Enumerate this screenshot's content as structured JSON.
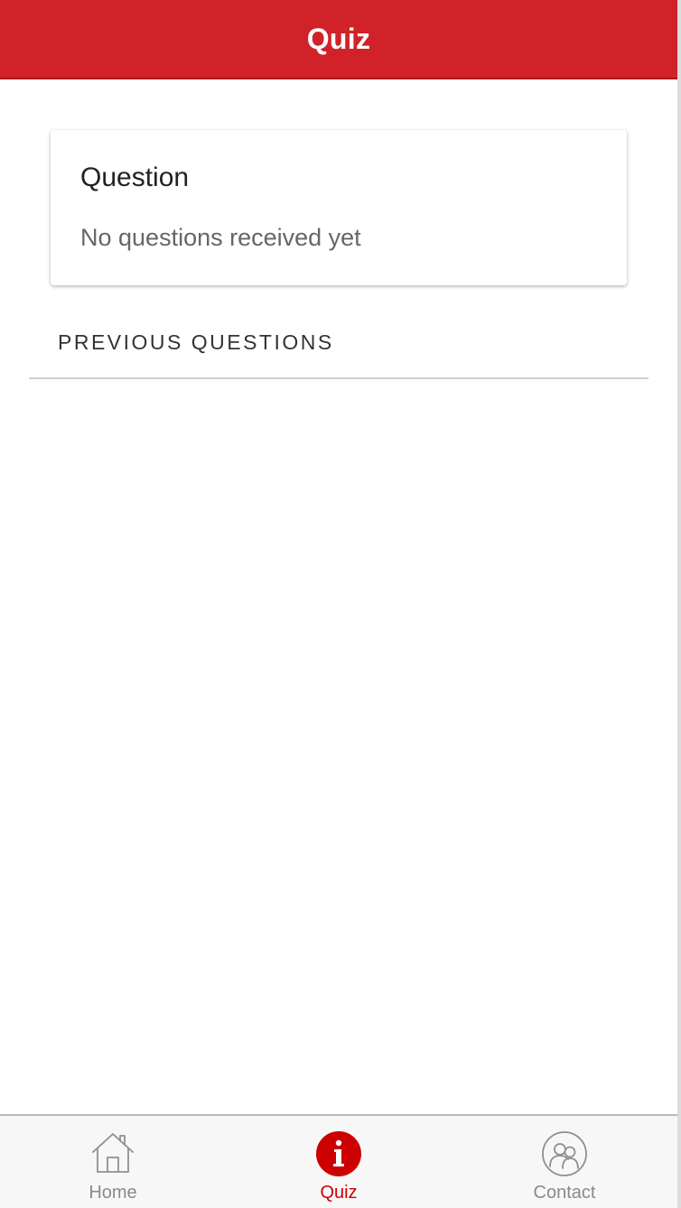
{
  "header": {
    "title": "Quiz",
    "background_color": "#d12229"
  },
  "question_card": {
    "title": "Question",
    "message": "No questions received yet"
  },
  "previous_questions": {
    "heading": "PREVIOUS QUESTIONS",
    "items": []
  },
  "tabbar": {
    "active_color": "#cc0000",
    "inactive_color": "#8a8a8a",
    "tabs": [
      {
        "label": "Home",
        "icon": "home-icon",
        "active": false
      },
      {
        "label": "Quiz",
        "icon": "info-icon",
        "active": true
      },
      {
        "label": "Contact",
        "icon": "contact-icon",
        "active": false
      }
    ]
  }
}
